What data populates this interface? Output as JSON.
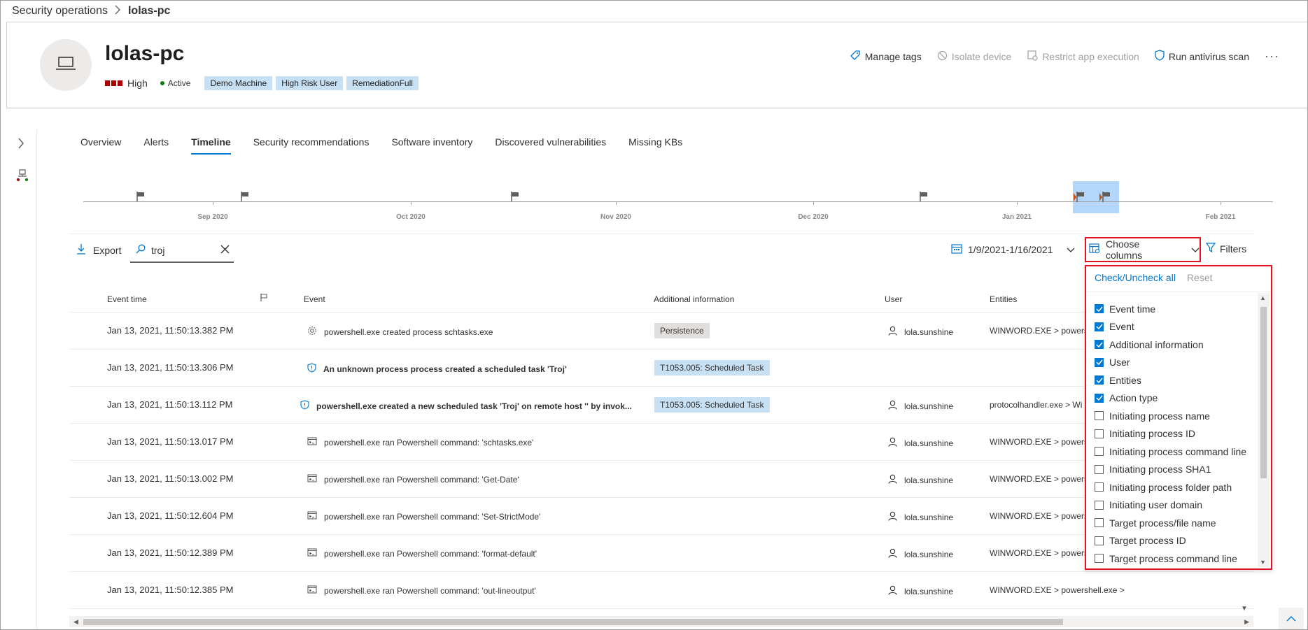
{
  "breadcrumb": {
    "parent": "Security operations",
    "current": "lolas-pc"
  },
  "device": {
    "name": "lolas-pc",
    "risk": "High",
    "status": "Active",
    "tags": [
      "Demo Machine",
      "High Risk User",
      "RemediationFull"
    ]
  },
  "actions": {
    "manage_tags": "Manage tags",
    "isolate": "Isolate device",
    "restrict": "Restrict app execution",
    "antivirus": "Run antivirus scan",
    "more": "···"
  },
  "tabs": [
    "Overview",
    "Alerts",
    "Timeline",
    "Security recommendations",
    "Software inventory",
    "Discovered vulnerabilities",
    "Missing KBs"
  ],
  "timeline": {
    "months": [
      "Sep 2020",
      "Oct 2020",
      "Nov 2020",
      "Dec 2020",
      "Jan 2021",
      "Feb 2021"
    ]
  },
  "toolbar": {
    "export": "Export",
    "search_value": "troj",
    "date_range": "1/9/2021-1/16/2021",
    "choose_columns": "Choose columns",
    "filters": "Filters"
  },
  "table": {
    "headers": {
      "time": "Event time",
      "event": "Event",
      "info": "Additional information",
      "user": "User",
      "entities": "Entities"
    },
    "rows": [
      {
        "time": "Jan 13, 2021, 11:50:13.382 PM",
        "event": "powershell.exe created process schtasks.exe",
        "info": "Persistence",
        "user": "lola.sunshine",
        "entities": "WINWORD.EXE > powers"
      },
      {
        "time": "Jan 13, 2021, 11:50:13.306 PM",
        "event": "An unknown process process created a scheduled task 'Troj'",
        "info": "T1053.005: Scheduled Task",
        "user": "",
        "entities": ""
      },
      {
        "time": "Jan 13, 2021, 11:50:13.112 PM",
        "event": "powershell.exe created a new scheduled task 'Troj' on remote host '' by invok...",
        "info": "T1053.005: Scheduled Task",
        "user": "lola.sunshine",
        "entities": "protocolhandler.exe > Wi"
      },
      {
        "time": "Jan 13, 2021, 11:50:13.017 PM",
        "event": "powershell.exe ran Powershell command: 'schtasks.exe'",
        "info": "",
        "user": "lola.sunshine",
        "entities": "WINWORD.EXE > powers"
      },
      {
        "time": "Jan 13, 2021, 11:50:13.002 PM",
        "event": "powershell.exe ran Powershell command: 'Get-Date'",
        "info": "",
        "user": "lola.sunshine",
        "entities": "WINWORD.EXE > powers"
      },
      {
        "time": "Jan 13, 2021, 11:50:12.604 PM",
        "event": "powershell.exe ran Powershell command: 'Set-StrictMode'",
        "info": "",
        "user": "lola.sunshine",
        "entities": "WINWORD.EXE > powers"
      },
      {
        "time": "Jan 13, 2021, 11:50:12.389 PM",
        "event": "powershell.exe ran Powershell command: 'format-default'",
        "info": "",
        "user": "lola.sunshine",
        "entities": "WINWORD.EXE > powers"
      },
      {
        "time": "Jan 13, 2021, 11:50:12.385 PM",
        "event": "powershell.exe ran Powershell command: 'out-lineoutput'",
        "info": "",
        "user": "lola.sunshine",
        "entities": "WINWORD.EXE > powershell.exe >"
      }
    ]
  },
  "column_panel": {
    "check_all": "Check/Uncheck all",
    "reset": "Reset",
    "items": [
      {
        "label": "Event time",
        "checked": true
      },
      {
        "label": "Event",
        "checked": true
      },
      {
        "label": "Additional information",
        "checked": true
      },
      {
        "label": "User",
        "checked": true
      },
      {
        "label": "Entities",
        "checked": true
      },
      {
        "label": "Action type",
        "checked": true
      },
      {
        "label": "Initiating process name",
        "checked": false
      },
      {
        "label": "Initiating process ID",
        "checked": false
      },
      {
        "label": "Initiating process command line",
        "checked": false
      },
      {
        "label": "Initiating process SHA1",
        "checked": false
      },
      {
        "label": "Initiating process folder path",
        "checked": false
      },
      {
        "label": "Initiating user domain",
        "checked": false
      },
      {
        "label": "Target process/file name",
        "checked": false
      },
      {
        "label": "Target process ID",
        "checked": false
      },
      {
        "label": "Target process command line",
        "checked": false
      }
    ]
  },
  "colors": {
    "accent": "#0078d4",
    "risk": "#a80000",
    "highlight_border": "#e81123",
    "tag_bg": "#c7e0f4"
  }
}
